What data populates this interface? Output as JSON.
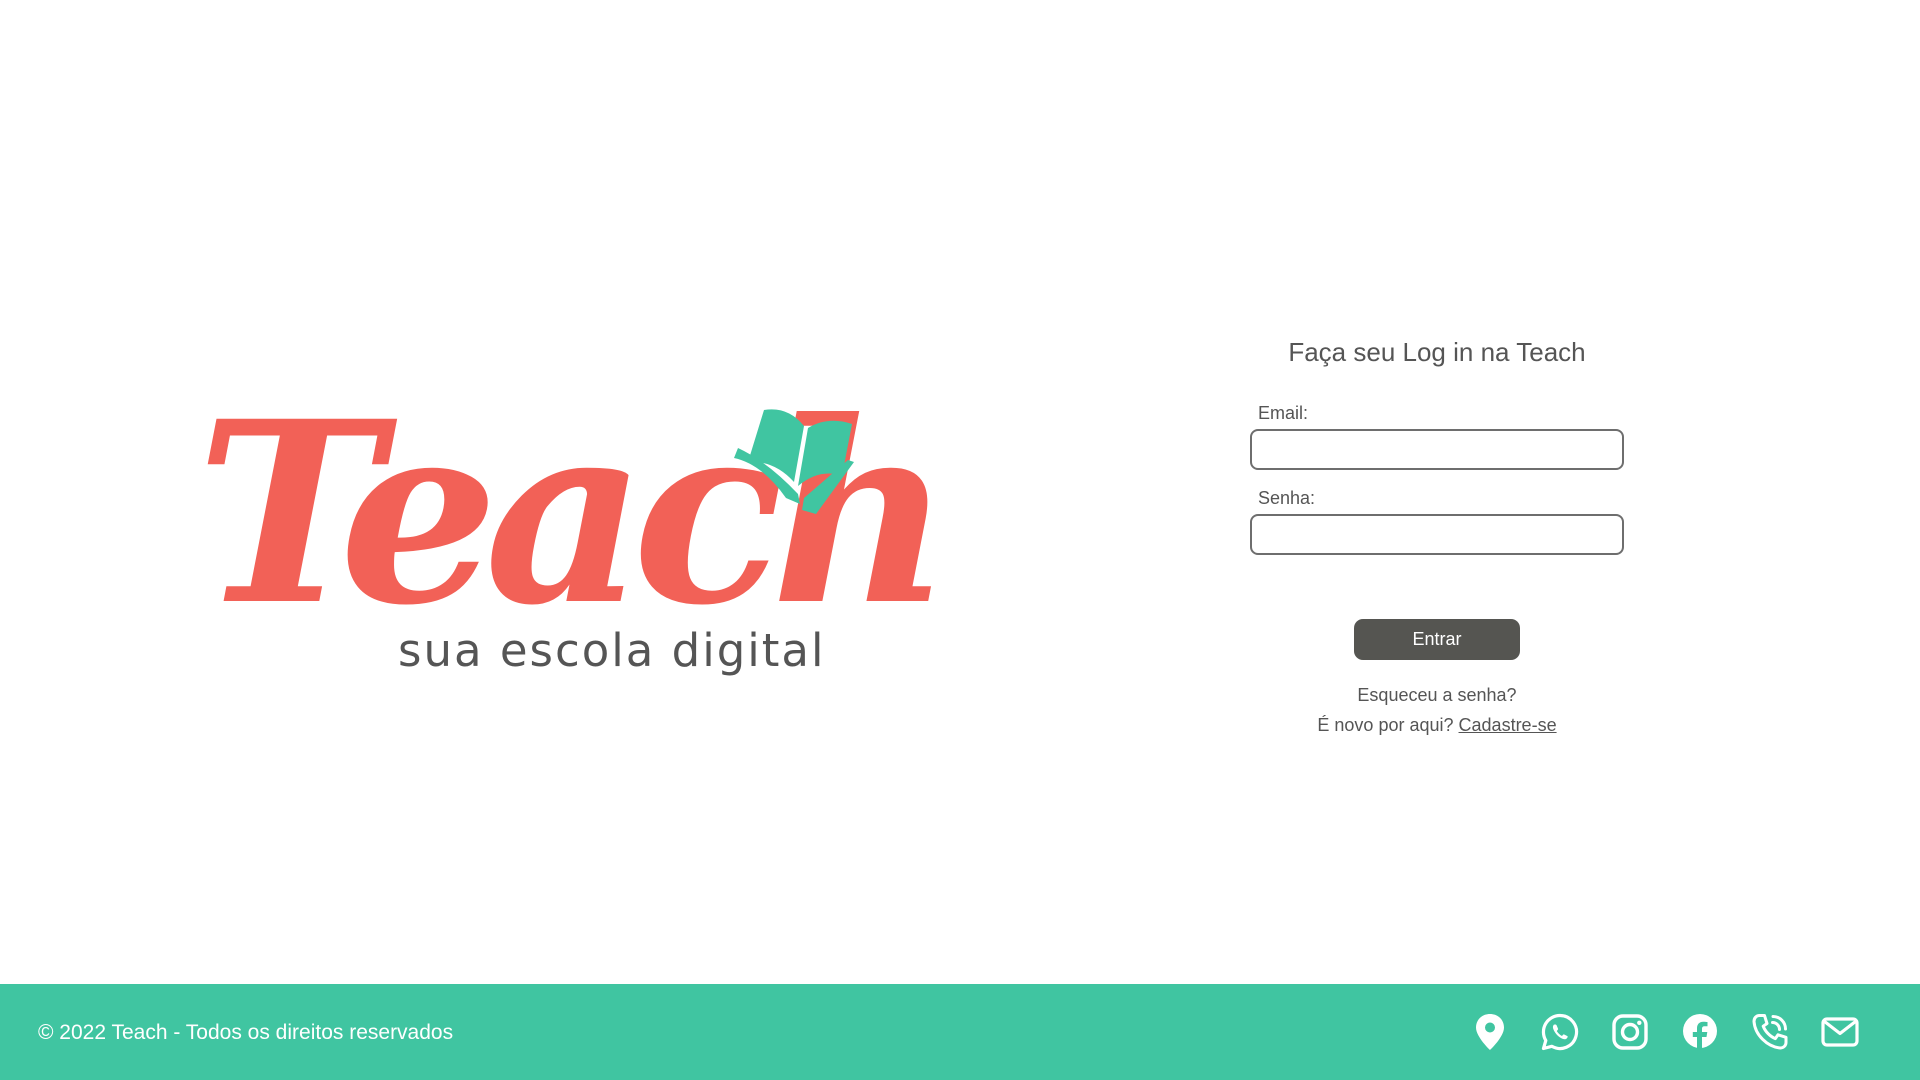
{
  "brand": {
    "logo_wordmark": "Teach",
    "logo_tagline": "sua escola digital"
  },
  "login": {
    "title": "Faça seu Log in na Teach",
    "email_label": "Email:",
    "email_value": "",
    "password_label": "Senha:",
    "password_value": "",
    "submit_label": "Entrar",
    "forgot_link": "Esqueceu a senha?",
    "register_prompt": "É novo por aqui?",
    "register_link": "Cadastre-se"
  },
  "footer": {
    "copyright": "© 2022 Teach - Todos os direitos reservados",
    "icons": [
      "location-pin-icon",
      "whatsapp-icon",
      "instagram-icon",
      "facebook-icon",
      "phone-icon",
      "mail-icon"
    ]
  },
  "colors": {
    "brand_coral": "#f26157",
    "brand_teal": "#40c5a1",
    "button_dark": "#555551",
    "text_gray": "#555555",
    "background": "#ffffff"
  }
}
